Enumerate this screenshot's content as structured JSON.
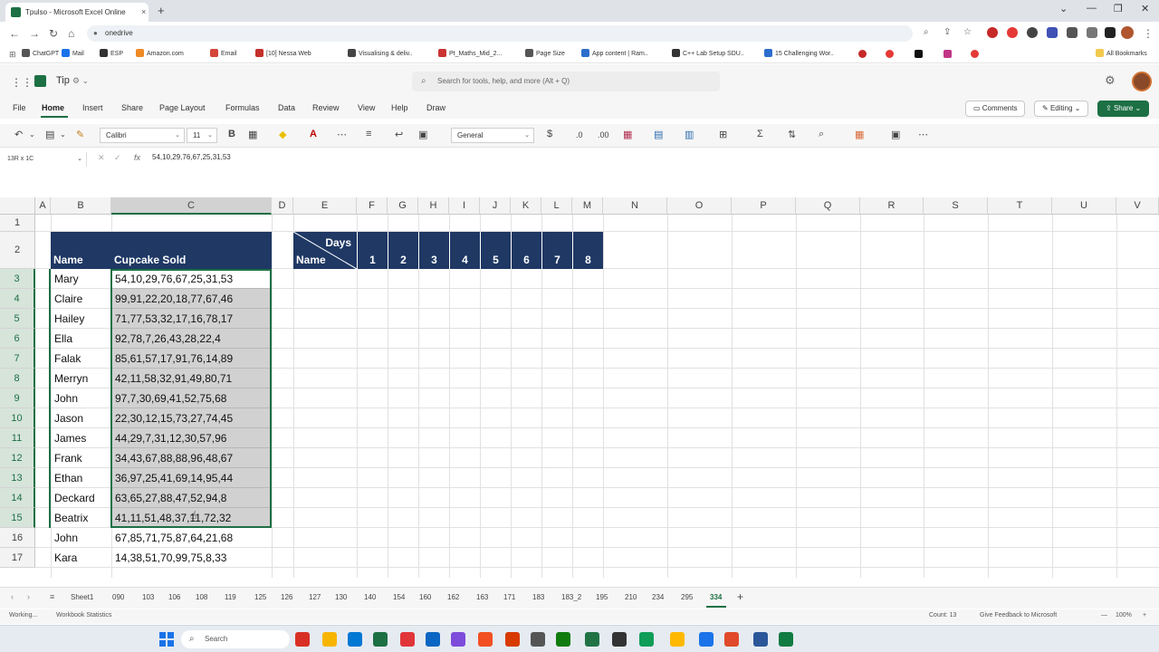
{
  "browser": {
    "tab_title": "Tpulso - Microsoft Excel Online",
    "tab_close": "×",
    "new_tab": "+",
    "url": "onedrive",
    "window_controls": [
      "⌄",
      "—",
      "❐",
      "✕"
    ],
    "bookmarks": [
      {
        "label": "ChatGPT",
        "color": "#555555"
      },
      {
        "label": "Mail",
        "color": "#1a73e8"
      },
      {
        "label": "ESP",
        "color": "#333333"
      },
      {
        "label": "Amazon.com",
        "color": "#f08a24"
      },
      {
        "label": "Email",
        "color": "#d44638"
      },
      {
        "label": "[10] Nessa Web",
        "color": "#c4302b"
      },
      {
        "label": "Visualising & deliv..",
        "color": "#444444"
      },
      {
        "label": "Pt_Maths_Mid_2...",
        "color": "#cc3333"
      },
      {
        "label": "Page Size",
        "color": "#555555"
      },
      {
        "label": "App content | Ram..",
        "color": "#2c6ecb"
      },
      {
        "label": "C++ Lab Setup SDU..",
        "color": "#333333"
      },
      {
        "label": "15 Challenging Wor..",
        "color": "#2c6ecb"
      }
    ],
    "all_bookmarks": "All Bookmarks"
  },
  "app": {
    "doc_title": "Tip",
    "search_placeholder": "Search for tools, help, and more (Alt + Q)",
    "menu": [
      "File",
      "Home",
      "Insert",
      "Share",
      "Page Layout",
      "Formulas",
      "Data",
      "Review",
      "View",
      "Help",
      "Draw"
    ],
    "comments": "Comments",
    "editing": "Editing",
    "share": "Share",
    "font_name": "Calibri",
    "font_size": "11",
    "number_format": "General"
  },
  "formula_bar": {
    "name_box": "13R x 1C",
    "fx": "fx",
    "content": "54,10,29,76,67,25,31,53"
  },
  "grid": {
    "columns": [
      "A",
      "B",
      "C",
      "D",
      "E",
      "F",
      "G",
      "H",
      "I",
      "J",
      "K",
      "L",
      "M",
      "N",
      "O",
      "P",
      "Q",
      "R",
      "S",
      "T",
      "U",
      "V"
    ],
    "rows": [
      "1",
      "2",
      "3",
      "4",
      "5",
      "6",
      "7",
      "8",
      "9",
      "10",
      "11",
      "12",
      "13",
      "14",
      "15",
      "16",
      "17"
    ],
    "table_header": {
      "name": "Name",
      "sold": "Cupcake Sold"
    },
    "records": [
      {
        "name": "Mary",
        "sold": "54,10,29,76,67,25,31,53"
      },
      {
        "name": "Claire",
        "sold": "99,91,22,20,18,77,67,46"
      },
      {
        "name": "Hailey",
        "sold": "71,77,53,32,17,16,78,17"
      },
      {
        "name": "Ella",
        "sold": "92,78,7,26,43,28,22,4"
      },
      {
        "name": "Falak",
        "sold": "85,61,57,17,91,76,14,89"
      },
      {
        "name": "Merryn",
        "sold": "42,11,58,32,91,49,80,71"
      },
      {
        "name": "John",
        "sold": "97,7,30,69,41,52,75,68"
      },
      {
        "name": "Jason",
        "sold": "22,30,12,15,73,27,74,45"
      },
      {
        "name": "James",
        "sold": "44,29,7,31,12,30,57,96"
      },
      {
        "name": "Frank",
        "sold": "34,43,67,88,88,96,48,67"
      },
      {
        "name": "Ethan",
        "sold": "36,97,25,41,69,14,95,44"
      },
      {
        "name": "Deckard",
        "sold": "63,65,27,88,47,52,94,8"
      },
      {
        "name": "Beatrix",
        "sold": "41,11,51,48,37,11,72,32"
      },
      {
        "name": "John",
        "sold": "67,85,71,75,87,64,21,68"
      },
      {
        "name": "Kara",
        "sold": "14,38,51,70,99,75,8,33"
      }
    ],
    "days_table": {
      "days_label": "Days",
      "name_label": "Name",
      "days": [
        "1",
        "2",
        "3",
        "4",
        "5",
        "6",
        "7",
        "8"
      ]
    }
  },
  "sheets": {
    "tabs": [
      "Sheet1",
      "090",
      "103",
      "106",
      "108",
      "119",
      "125",
      "126",
      "127",
      "130",
      "140",
      "154",
      "160",
      "162",
      "163",
      "171",
      "183",
      "183_2",
      "195",
      "210",
      "234",
      "295",
      "334"
    ],
    "active": "334",
    "add": "+"
  },
  "status": {
    "left": "Working...",
    "stats": "Workbook Statistics",
    "count": "Count: 13",
    "feedback": "Give Feedback to Microsoft",
    "zoom": "100%"
  },
  "taskbar": {
    "search": "Search",
    "app_colors": [
      "#d93025",
      "#f7b500",
      "#0078d4",
      "#1d7044",
      "#e0363a",
      "#0a66c2",
      "#7d4cdb",
      "#f25022",
      "#d83b01",
      "#555555",
      "#107c10",
      "#217346",
      "#333333",
      "#0f9d58",
      "#ffb900",
      "#1a73e8",
      "#e04a2a",
      "#2b579a",
      "#107c41"
    ]
  },
  "colors": {
    "accent": "#1d7044",
    "header_fill": "#1f3864"
  }
}
